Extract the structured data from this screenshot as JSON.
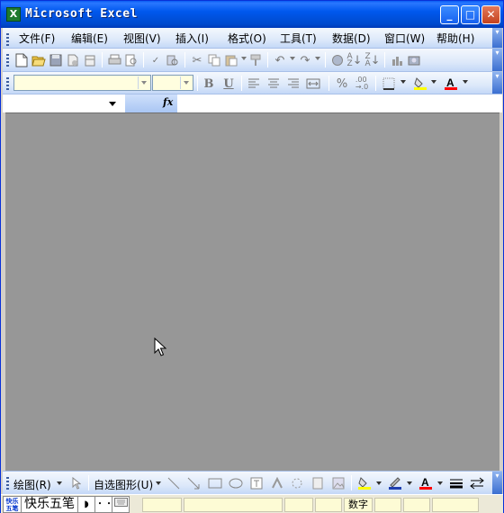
{
  "window": {
    "title": "Microsoft Excel",
    "app_icon": "excel-icon",
    "minimize_glyph": "_",
    "maximize_glyph": "□",
    "close_glyph": "✕"
  },
  "menu": {
    "items": [
      "文件(F)",
      "编辑(E)",
      "视图(V)",
      "插入(I)",
      "格式(O)",
      "工具(T)",
      "数据(D)",
      "窗口(W)",
      "帮助(H)"
    ]
  },
  "standard_toolbar": {
    "icons": [
      "new-icon",
      "open-icon",
      "save-icon",
      "permission-icon",
      "email-icon",
      "print-icon",
      "print-preview-icon",
      "spelling-icon",
      "research-icon",
      "cut-icon",
      "copy-icon",
      "paste-icon",
      "format-painter-icon",
      "undo-icon",
      "redo-icon",
      "hyperlink-icon",
      "sort-ascending-icon",
      "sort-descending-icon",
      "chart-wizard-icon",
      "drawing-icon"
    ]
  },
  "formatting_toolbar": {
    "font_name": "",
    "font_size": "",
    "bold_label": "B",
    "underline_label": "U",
    "percent_label": "%"
  },
  "formula_bar": {
    "name_box": "",
    "fx_label": "fx",
    "formula": ""
  },
  "drawing_toolbar": {
    "draw_label": "绘图(R)",
    "autoshapes_label": "自选图形(U)"
  },
  "status_bar": {
    "ime_logo": "快乐五笔",
    "ime_name": "快乐五笔",
    "ime_moon": "◗",
    "ime_punct": "・・",
    "num_indicator": "数字"
  },
  "colors": {
    "title_bar": "#0054e3",
    "toolbar_bg": "#dde9fa",
    "workspace": "#979797",
    "font_box_bg": "#fffedf",
    "fill_color": "#ffff00",
    "font_color": "#ff0000"
  }
}
